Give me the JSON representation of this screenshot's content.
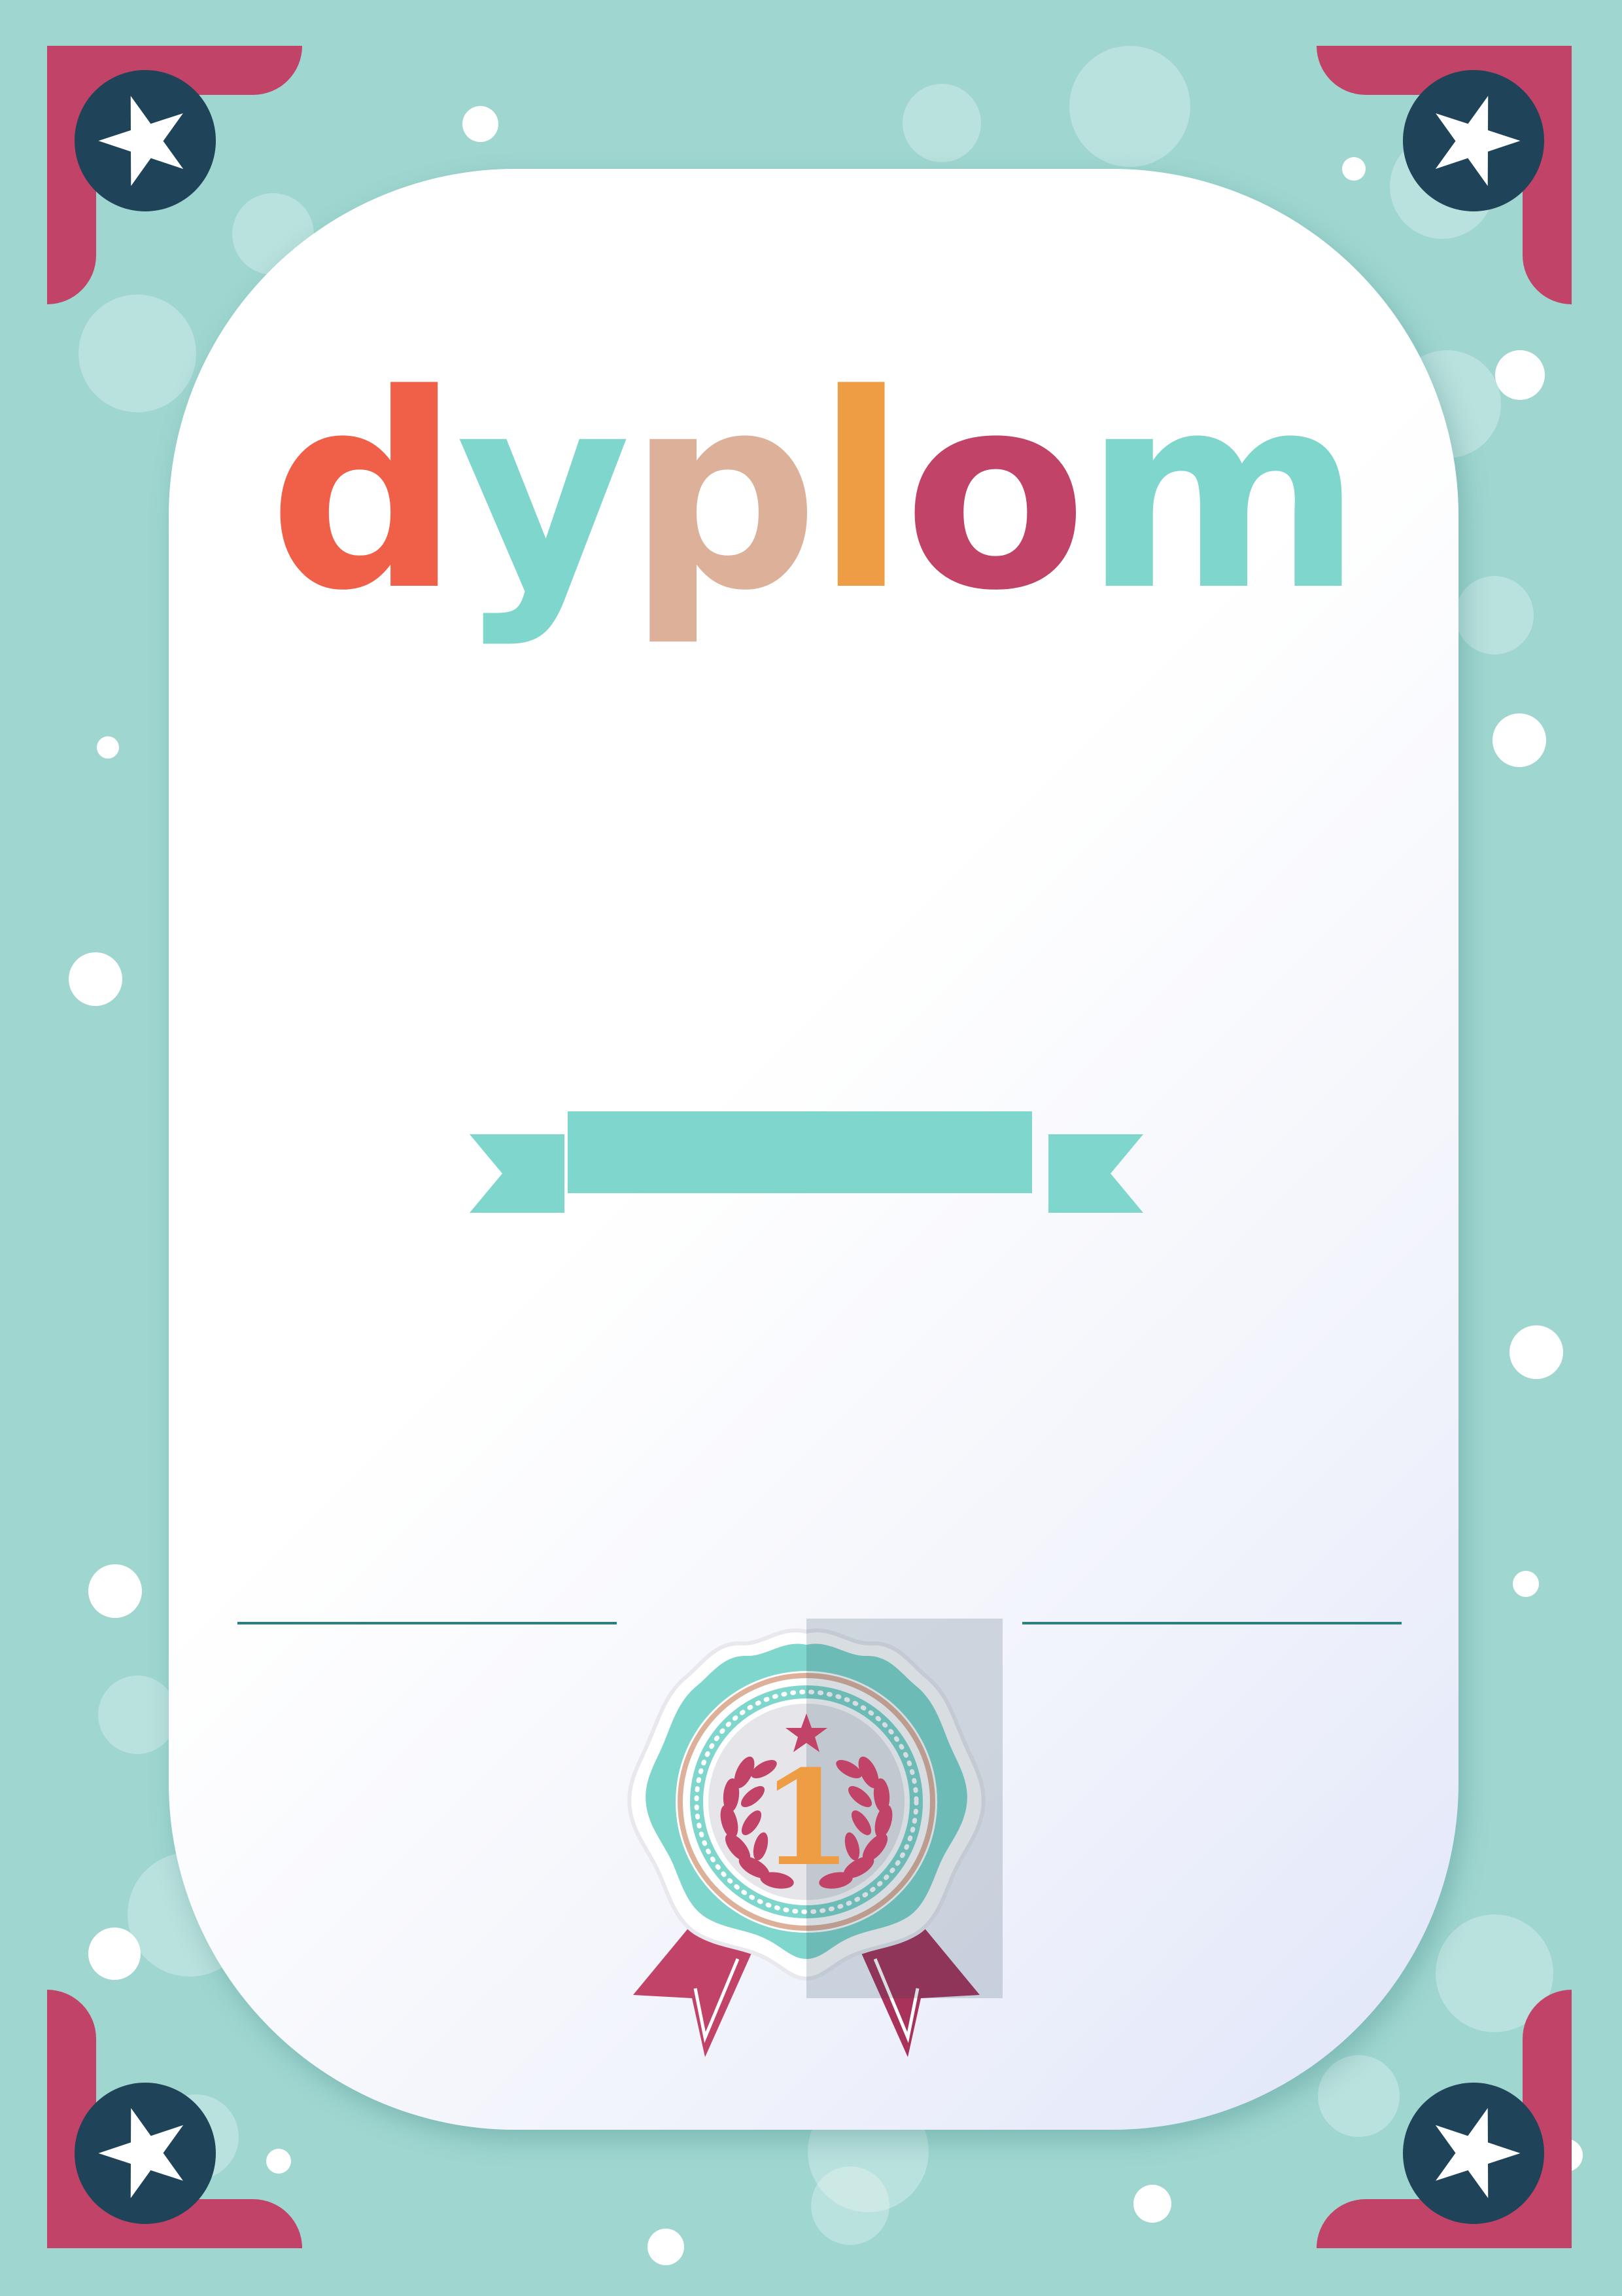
{
  "certificate": {
    "title_letters": [
      {
        "char": "d",
        "color": "#f06048"
      },
      {
        "char": "y",
        "color": "#7ed6cc"
      },
      {
        "char": "p",
        "color": "#ddb09a"
      },
      {
        "char": "l",
        "color": "#ee9d45"
      },
      {
        "char": "o",
        "color": "#c24368"
      },
      {
        "char": "m",
        "color": "#7ed6cc"
      }
    ],
    "medal_number": "1"
  },
  "colors": {
    "background": "#9fd6d0",
    "corner_accent": "#c24368",
    "corner_badge": "#1f4459",
    "ribbon": "#7ed6cc",
    "signature_line": "#2e7f80",
    "medal_teal": "#7ed6cc",
    "medal_ribbon": "#c24368",
    "number_gold": "#ee9d45"
  },
  "icons": [
    "star-icon",
    "medal-icon",
    "laurel-icon"
  ]
}
